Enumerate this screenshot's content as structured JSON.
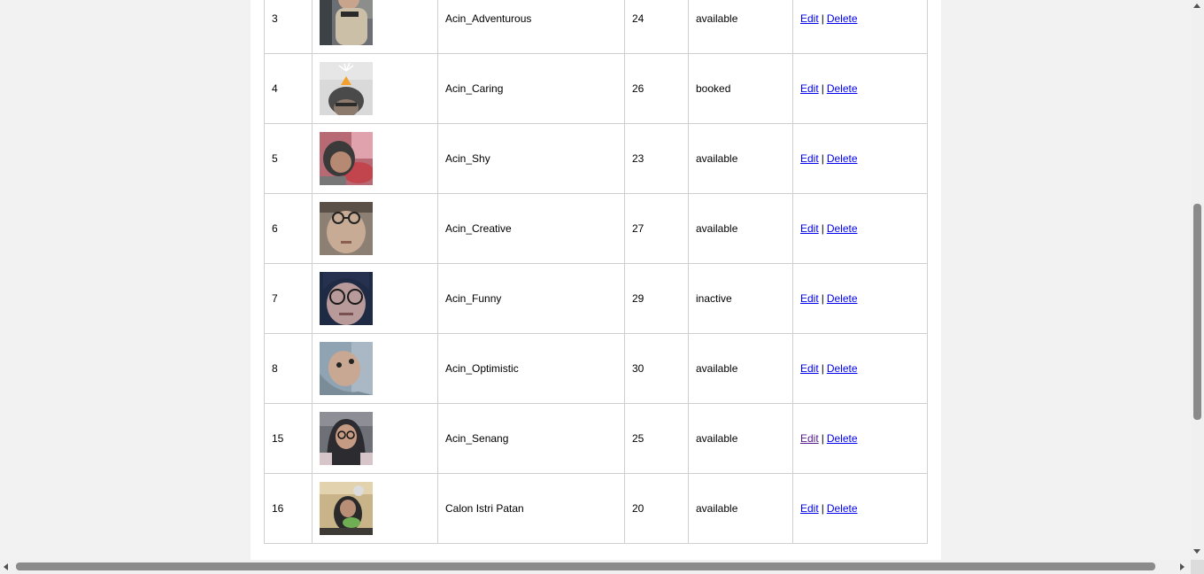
{
  "table": {
    "rows": [
      {
        "id": "3",
        "name": "Acin_Adventurous",
        "age": "24",
        "status": "available",
        "edit": "Edit",
        "sep": "|",
        "delete": "Delete",
        "edit_visited": false
      },
      {
        "id": "4",
        "name": "Acin_Caring",
        "age": "26",
        "status": "booked",
        "edit": "Edit",
        "sep": "|",
        "delete": "Delete",
        "edit_visited": false
      },
      {
        "id": "5",
        "name": "Acin_Shy",
        "age": "23",
        "status": "available",
        "edit": "Edit",
        "sep": "|",
        "delete": "Delete",
        "edit_visited": false
      },
      {
        "id": "6",
        "name": "Acin_Creative",
        "age": "27",
        "status": "available",
        "edit": "Edit",
        "sep": "|",
        "delete": "Delete",
        "edit_visited": false
      },
      {
        "id": "7",
        "name": "Acin_Funny",
        "age": "29",
        "status": "inactive",
        "edit": "Edit",
        "sep": "|",
        "delete": "Delete",
        "edit_visited": false
      },
      {
        "id": "8",
        "name": "Acin_Optimistic",
        "age": "30",
        "status": "available",
        "edit": "Edit",
        "sep": "|",
        "delete": "Delete",
        "edit_visited": false
      },
      {
        "id": "15",
        "name": "Acin_Senang",
        "age": "25",
        "status": "available",
        "edit": "Edit",
        "sep": "|",
        "delete": "Delete",
        "edit_visited": true
      },
      {
        "id": "16",
        "name": "Calon Istri Patan",
        "age": "20",
        "status": "available",
        "edit": "Edit",
        "sep": "|",
        "delete": "Delete",
        "edit_visited": false
      }
    ]
  },
  "colors": {
    "link": "#0000ee",
    "link_visited": "#551a8b",
    "page_bg": "#f2f2f2",
    "border": "#cfcfcf"
  }
}
